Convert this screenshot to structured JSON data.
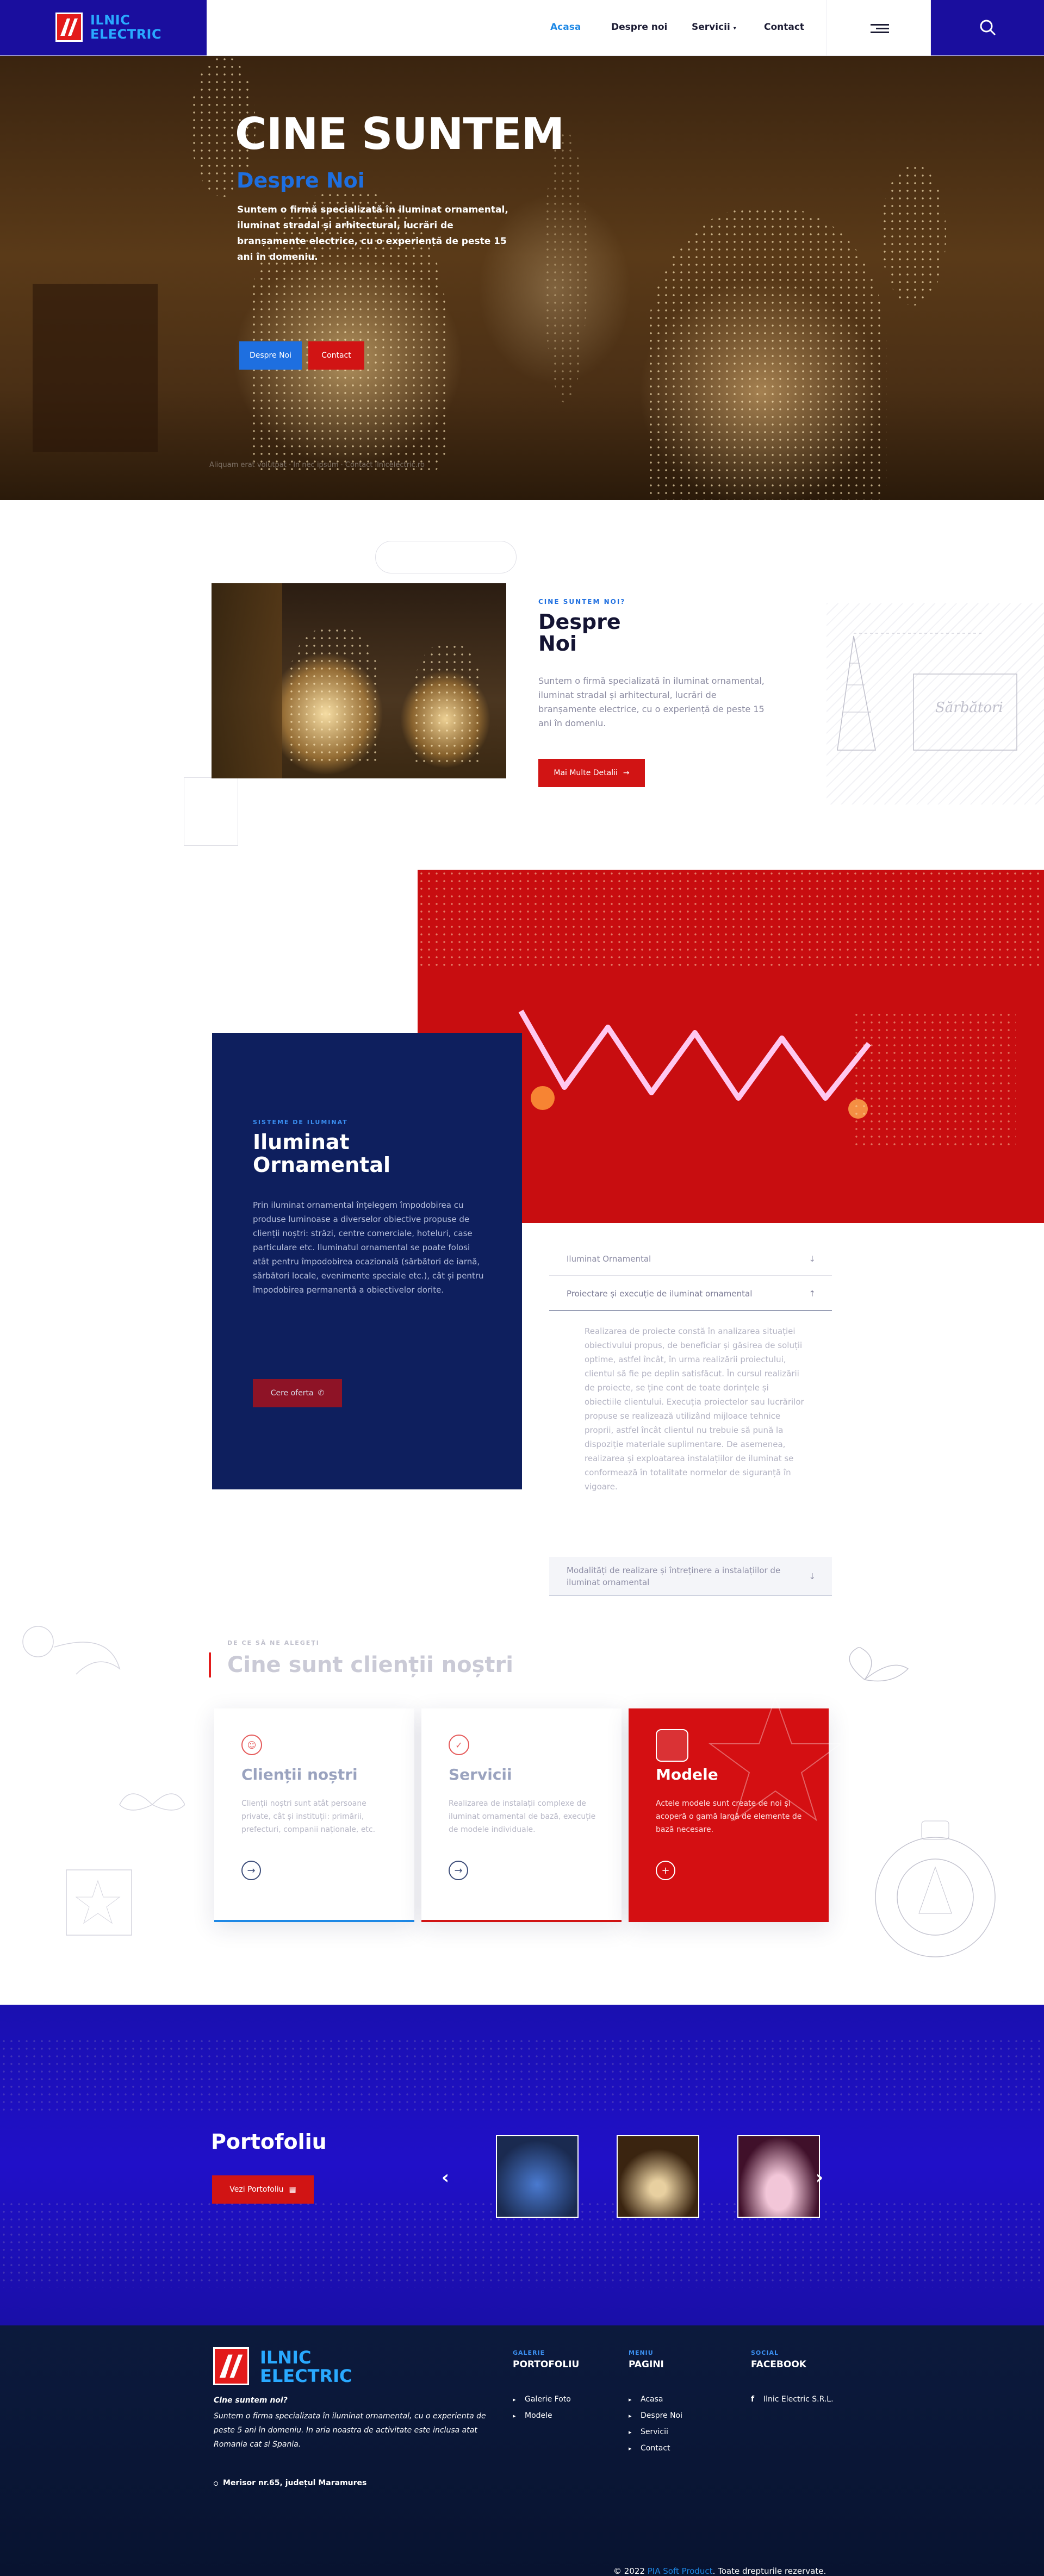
{
  "header": {
    "logo_line1": "ILNIC",
    "logo_line2": "ELECTRIC",
    "nav": [
      {
        "label": "Acasa",
        "active": true
      },
      {
        "label": "Despre noi",
        "active": false
      },
      {
        "label": "Servicii",
        "active": false
      },
      {
        "label": "Contact",
        "active": false
      }
    ],
    "nav_dropdown_icon": "chevron-down-icon",
    "menu_icon": "menu-icon",
    "search_icon": "search-icon"
  },
  "hero": {
    "title": "CINE SUNTEM",
    "subtitle": "Despre Noi",
    "text": "Suntem o firmă specializată în iluminat ornamental, iluminat stradal și arhitectural, lucrări de branșamente electrice, cu o experiență de peste 15 ani în domeniu.",
    "primary_button": "Despre Noi",
    "secondary_button": "Contact",
    "bottom_note": "Aliquam erat volutpat · In nec ipsum · Contact ilnicelectric.ro"
  },
  "about": {
    "kicker": "CINE SUNTEM NOI?",
    "title_line1": "Despre",
    "title_line2": "Noi",
    "text": "Suntem o firmă specializată în iluminat ornamental, iluminat stradal și arhitectural, lucrări de branșamente electrice, cu o experiență de peste 15 ani în domeniu.",
    "button": "Mai Multe Detalii",
    "button_icon": "arrow-right-icon"
  },
  "ornamental": {
    "kicker": "SISTEME DE ILUMINAT",
    "title_line1": "Iluminat",
    "title_line2": "Ornamental",
    "text": "Prin iluminat ornamental înțelegem împodobirea cu produse luminoase a diverselor obiective propuse de clienții noștri: străzi, centre comerciale, hoteluri, case particulare etc. Iluminatul ornamental se poate folosi atât pentru împodobirea ocazională (sărbători de iarnă, sărbători locale, evenimente speciale etc.), cât și pentru împodobirea permanentă a obiectivelor dorite.",
    "button": "Cere oferta",
    "button_icon": "phone-icon",
    "accordion": [
      {
        "label": "Iluminat Ornamental",
        "open": false
      },
      {
        "label": "Proiectare și execuție de iluminat ornamental",
        "open": true
      },
      {
        "label": "Modalități de realizare și întreținere a instalațiilor de iluminat ornamental",
        "open": false
      }
    ],
    "accordion_body": "Realizarea de proiecte constă în analizarea situației obiectivului propus, de beneficiar și găsirea de soluții optime, astfel încât, în urma realizării proiectului, clientul să fie pe deplin satisfăcut. În cursul realizării de proiecte, se ține cont de toate dorințele și obiectiile clientului. Execuția proiectelor sau lucrărilor propuse se realizează utilizând mijloace tehnice proprii, astfel încât clientul nu trebuie să pună la dispoziție materiale suplimentare. De asemenea, realizarea și exploatarea instalațiilor de iluminat se conformează în totalitate normelor de siguranță în vigoare."
  },
  "clients": {
    "kicker": "DE CE SĂ NE ALEGEȚI",
    "title": "Cine sunt clienții noștri",
    "cards": [
      {
        "title": "Clienții noștri",
        "text": "Clienții noștri sunt atât persoane private, cât și instituții: primării, prefecturi, companii naționale, etc.",
        "icon": "user-icon",
        "accent": "#e55a5a",
        "bar": "#1e88e5"
      },
      {
        "title": "Servicii",
        "text": "Realizarea de instalații complexe de iluminat ornamental de bază, execuție de modele individuale.",
        "icon": "check-icon",
        "accent": "#e55a5a",
        "bar": "#d11414"
      },
      {
        "title": "Modele",
        "text": "Actele modele sunt create de noi și acoperă o gamă largă de elemente de bază necesare.",
        "icon": "plus-icon",
        "accent": "#ffffff",
        "bar": "#d11414"
      }
    ]
  },
  "portfolio": {
    "title": "Portofoliu",
    "button": "Vezi Portofoliu",
    "button_icon": "images-icon",
    "prev_icon": "chevron-left-icon",
    "next_icon": "chevron-right-icon"
  },
  "footer": {
    "logo_line1": "ILNIC",
    "logo_line2": "ELECTRIC",
    "about_head": "Cine suntem noi?",
    "about_text": "Suntem o firma specializata în iluminat ornamental, cu o experienta de peste 5 ani în domeniu. In aria noastra de activitate este inclusa atat Romania cat si Spania.",
    "address": "Merisor nr.65, județul Maramures",
    "col1": {
      "kicker": "GALERIE",
      "head": "PORTOFOLIU",
      "links": [
        "Galerie Foto",
        "Modele"
      ]
    },
    "col2": {
      "kicker": "MENIU",
      "head": "PAGINI",
      "links": [
        "Acasa",
        "Despre Noi",
        "Servicii",
        "Contact"
      ]
    },
    "col3": {
      "kicker": "SOCIAL",
      "head": "FACEBOOK",
      "links": [
        "Ilnic Electric S.R.L."
      ]
    },
    "copyright_prefix": "© 2022",
    "copyright_link": "PIA Soft Product",
    "copyright_suffix": ". Toate drepturile rezervate."
  },
  "colors": {
    "brand_blue": "#1a0e9e",
    "accent_blue": "#1e88e5",
    "brand_red": "#d11414",
    "navy": "#0e1f5e"
  }
}
